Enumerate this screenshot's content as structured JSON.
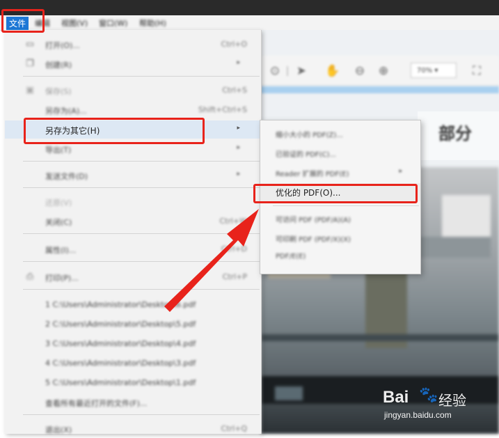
{
  "menubar": {
    "items": [
      "文件",
      "编辑",
      "视图(V)",
      "窗口(W)",
      "帮助(H)"
    ]
  },
  "toolbar": {
    "zoom": "70%"
  },
  "document": {
    "heading": "部分"
  },
  "file_menu": {
    "items": [
      {
        "label": "打开(O)...",
        "shortcut": "Ctrl+O"
      },
      {
        "label": "创建(R)",
        "submenu": true
      },
      {
        "label": "保存(S)",
        "shortcut": "Ctrl+S"
      },
      {
        "label": "另存为(A)...",
        "shortcut": "Shift+Ctrl+S"
      },
      {
        "label": "另存为其它(H)",
        "submenu": true
      },
      {
        "label": "导出(T)",
        "submenu": true
      },
      {
        "label": "发送文件(D)",
        "submenu": true
      },
      {
        "label": "还原(V)"
      },
      {
        "label": "关闭(C)",
        "shortcut": "Ctrl+W"
      },
      {
        "label": "属性(I)...",
        "shortcut": "Ctrl+D"
      },
      {
        "label": "打印(P)...",
        "shortcut": "Ctrl+P"
      },
      {
        "label": "1 C:\\Users\\Administrator\\Desktop\\6.pdf"
      },
      {
        "label": "2 C:\\Users\\Administrator\\Desktop\\5.pdf"
      },
      {
        "label": "3 C:\\Users\\Administrator\\Desktop\\4.pdf"
      },
      {
        "label": "4 C:\\Users\\Administrator\\Desktop\\3.pdf"
      },
      {
        "label": "5 C:\\Users\\Administrator\\Desktop\\1.pdf"
      },
      {
        "label": "查看所有最近打开的文件(F)..."
      },
      {
        "label": "退出(X)",
        "shortcut": "Ctrl+Q"
      }
    ]
  },
  "submenu": {
    "items": [
      {
        "label": "缩小大小的 PDF(Z)..."
      },
      {
        "label": "已验证的 PDF(C)..."
      },
      {
        "label": "Reader 扩展的 PDF(E)",
        "submenu": true
      },
      {
        "label": "优化的 PDF(O)..."
      },
      {
        "label": "可访问 PDF (PDF/A)(A)"
      },
      {
        "label": "可印刷 PDF (PDF/X)(X)"
      },
      {
        "label": "PDF/E(E)"
      }
    ]
  },
  "watermark": {
    "logo": "Bai",
    "brand": "经验",
    "url": "jingyan.baidu.com"
  },
  "colors": {
    "highlight": "#e8231b",
    "menu_selected": "#1e78d6"
  }
}
